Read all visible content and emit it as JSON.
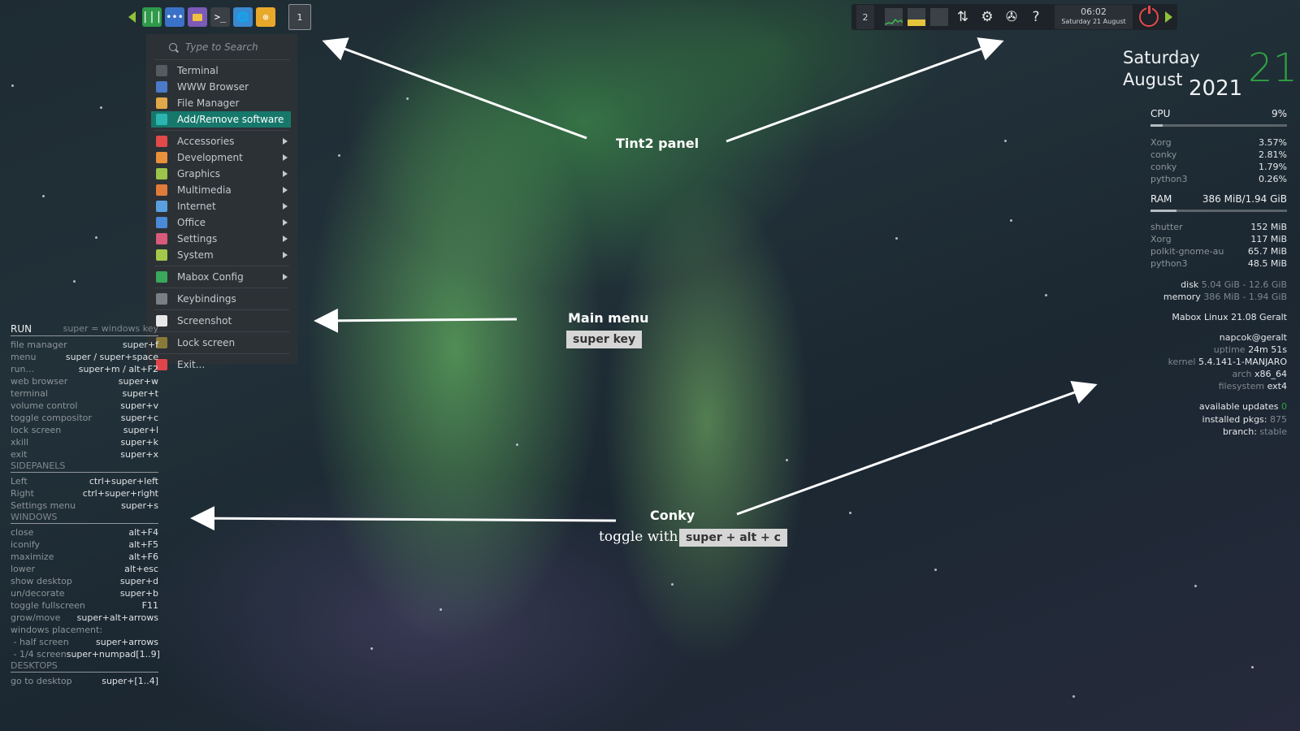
{
  "left_panel": {
    "launchers": [
      "mabox-menu-icon",
      "apps-icon",
      "file-manager-icon",
      "terminal-icon",
      "browser-icon",
      "settings-icon"
    ],
    "workspace": "1"
  },
  "right_panel": {
    "workspace": "2",
    "clock_time": "06:02",
    "clock_date": "Saturday 21 August"
  },
  "menu": {
    "search_placeholder": "Type to Search",
    "items": [
      {
        "label": "Terminal",
        "icon": "terminal-icon",
        "color": "#555b60"
      },
      {
        "label": "WWW Browser",
        "icon": "browser-icon",
        "color": "#4a7ac8"
      },
      {
        "label": "File Manager",
        "icon": "folder-icon",
        "color": "#e0a84a"
      },
      {
        "label": "Add/Remove software",
        "icon": "package-icon",
        "color": "#2cb5b0"
      },
      {
        "label": "Accessories",
        "icon": "accessories-icon",
        "color": "#e24a4a"
      },
      {
        "label": "Development",
        "icon": "development-icon",
        "color": "#e8903a"
      },
      {
        "label": "Graphics",
        "icon": "graphics-icon",
        "color": "#9bc44a"
      },
      {
        "label": "Multimedia",
        "icon": "multimedia-icon",
        "color": "#e07b3a"
      },
      {
        "label": "Internet",
        "icon": "internet-icon",
        "color": "#5aa0e0"
      },
      {
        "label": "Office",
        "icon": "office-icon",
        "color": "#4a8ad8"
      },
      {
        "label": "Settings",
        "icon": "settings-icon",
        "color": "#d85a7a"
      },
      {
        "label": "System",
        "icon": "system-icon",
        "color": "#a4c84a"
      },
      {
        "label": "Mabox Config",
        "icon": "mabox-icon",
        "color": "#3aa85a"
      },
      {
        "label": "Keybindings",
        "icon": "keybindings-icon",
        "color": "#7a7f85"
      },
      {
        "label": "Screenshot",
        "icon": "screenshot-icon",
        "color": "#e8e8e8"
      },
      {
        "label": "Lock screen",
        "icon": "lock-icon",
        "color": "#8a7a3a"
      },
      {
        "label": "Exit...",
        "icon": "power-icon",
        "color": "#e0454a"
      }
    ]
  },
  "annotations": {
    "tint2": "Tint2 panel",
    "main_menu": "Main menu",
    "super_key": "super key",
    "conky": "Conky",
    "toggle": "toggle with",
    "toggle_key": "super + alt + c"
  },
  "left_conky": {
    "run": {
      "title": "RUN",
      "note": "super = windows key",
      "rows": [
        {
          "k": "file manager",
          "v": "super+f"
        },
        {
          "k": "menu",
          "v": "super / super+space"
        },
        {
          "k": "run...",
          "v": "super+m / alt+F2"
        },
        {
          "k": "web browser",
          "v": "super+w"
        },
        {
          "k": "terminal",
          "v": "super+t"
        },
        {
          "k": "volume control",
          "v": "super+v"
        },
        {
          "k": "toggle compositor",
          "v": "super+c"
        },
        {
          "k": "lock screen",
          "v": "super+l"
        },
        {
          "k": "xkill",
          "v": "super+k"
        },
        {
          "k": "exit",
          "v": "super+x"
        }
      ]
    },
    "sidepanels": {
      "title": "SIDEPANELS",
      "rows": [
        {
          "k": "Left",
          "v": "ctrl+super+left"
        },
        {
          "k": "Right",
          "v": "ctrl+super+right"
        },
        {
          "k": "Settings menu",
          "v": "super+s"
        }
      ]
    },
    "windows": {
      "title": "WINDOWS",
      "rows": [
        {
          "k": "close",
          "v": "alt+F4"
        },
        {
          "k": "iconify",
          "v": "alt+F5"
        },
        {
          "k": "maximize",
          "v": "alt+F6"
        },
        {
          "k": "lower",
          "v": "alt+esc"
        },
        {
          "k": "show desktop",
          "v": "super+d"
        },
        {
          "k": "un/decorate",
          "v": "super+b"
        },
        {
          "k": "toggle fullscreen",
          "v": "F11"
        },
        {
          "k": "grow/move",
          "v": "super+alt+arrows"
        },
        {
          "k": "windows placement:",
          "v": ""
        },
        {
          "k": " - half screen",
          "v": "super+arrows"
        },
        {
          "k": " - 1/4 screen",
          "v": "super+numpad[1..9]"
        }
      ]
    },
    "desktops": {
      "title": "DESKTOPS",
      "rows": [
        {
          "k": "go to desktop",
          "v": "super+[1..4]"
        }
      ]
    }
  },
  "right_conky": {
    "day": "Saturday",
    "month": "August",
    "year": "2021",
    "date_num": "21",
    "cpu_label": "CPU",
    "cpu_value": "9%",
    "cpu_fraction": 0.09,
    "cpu_procs": [
      {
        "k": "Xorg",
        "v": "3.57%"
      },
      {
        "k": "conky",
        "v": "2.81%"
      },
      {
        "k": "conky",
        "v": "1.79%"
      },
      {
        "k": "python3",
        "v": "0.26%"
      }
    ],
    "ram_label": "RAM",
    "ram_value": "386 MiB/1.94 GiB",
    "ram_fraction": 0.19,
    "mem_procs": [
      {
        "k": "shutter",
        "v": "152 MiB"
      },
      {
        "k": "Xorg",
        "v": "117 MiB"
      },
      {
        "k": "polkit-gnome-au",
        "v": "65.7 MiB"
      },
      {
        "k": "python3",
        "v": "48.5 MiB"
      }
    ],
    "disk_label": "disk",
    "disk_value": "5.04 GiB - 12.6 GiB",
    "memory_label": "memory",
    "memory_value": "386 MiB - 1.94 GiB",
    "distro": "Mabox Linux 21.08 Geralt",
    "user": "napcok@geralt",
    "uptime_label": "uptime",
    "uptime_value": "24m 51s",
    "kernel_label": "kernel",
    "kernel_value": "5.4.141-1-MANJARO",
    "arch_label": "arch",
    "arch_value": "x86_64",
    "fs_label": "filesystem",
    "fs_value": "ext4",
    "updates_label": "available updates",
    "updates_value": "0",
    "pkgs_label": "installed pkgs:",
    "pkgs_value": "875",
    "branch_label": "branch:",
    "branch_value": "stable"
  }
}
